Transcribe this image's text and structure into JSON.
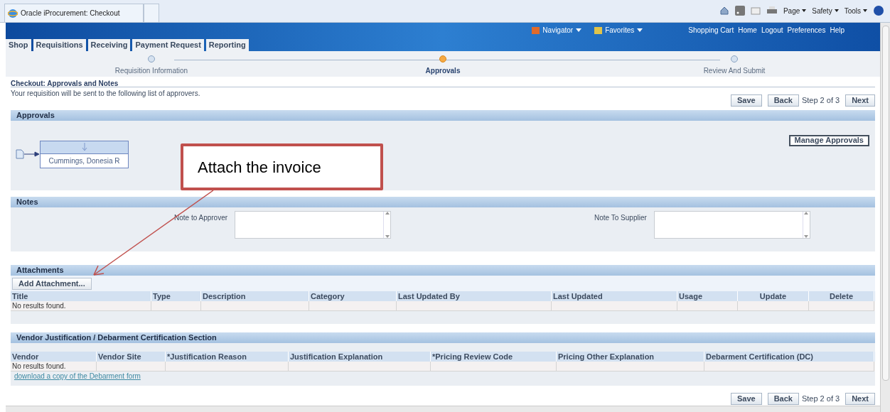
{
  "browser": {
    "tab_title": "Oracle iProcurement: Checkout",
    "toolbar": [
      "Page",
      "Safety",
      "Tools"
    ]
  },
  "header": {
    "menus": [
      "Navigator",
      "Favorites"
    ],
    "links": [
      "Shopping Cart",
      "Home",
      "Logout",
      "Preferences",
      "Help"
    ]
  },
  "tabs": [
    {
      "label": "Shop",
      "selected": false
    },
    {
      "label": "Requisitions",
      "selected": false
    },
    {
      "label": "Receiving",
      "selected": false
    },
    {
      "label": "Payment Request",
      "selected": false
    },
    {
      "label": "Reporting",
      "selected": false
    }
  ],
  "train": [
    {
      "label": "Requisition Information",
      "selected": false
    },
    {
      "label": "Approvals",
      "selected": true
    },
    {
      "label": "Review And Submit",
      "selected": false
    }
  ],
  "page": {
    "title": "Checkout: Approvals and Notes",
    "description": "Your requisition will be sent to the following list of approvers."
  },
  "nav_top": {
    "save": "Save",
    "back": "Back",
    "step": "Step 2 of 3",
    "next": "Next"
  },
  "approvals": {
    "title": "Approvals",
    "approver": "Cummings, Donesia R",
    "button": "Manage Approvals"
  },
  "notes": {
    "title": "Notes",
    "fields": [
      {
        "label": "Note to Approver"
      },
      {
        "label": "Note To Supplier"
      }
    ]
  },
  "attachments": {
    "title": "Attachments",
    "button": "Add Attachment...",
    "columns": [
      "Title",
      "Type",
      "Description",
      "Category",
      "Last Updated By",
      "Last Updated",
      "Usage",
      "Update",
      "Delete"
    ],
    "empty": "No results found."
  },
  "vendor": {
    "title": "Vendor Justification / Debarment Certification Section",
    "columns": [
      "Vendor",
      "Vendor Site",
      "*Justification Reason",
      "Justification Explanation",
      "*Pricing Review Code",
      "Pricing Other Explanation",
      "Debarment Certification (DC)"
    ],
    "empty": "No results found.",
    "link": "download a copy of the Debarment form"
  },
  "nav_bottom": {
    "save": "Save",
    "back": "Back",
    "step": "Step 2 of 3",
    "next": "Next"
  },
  "callout": {
    "text": "Attach the invoice"
  }
}
